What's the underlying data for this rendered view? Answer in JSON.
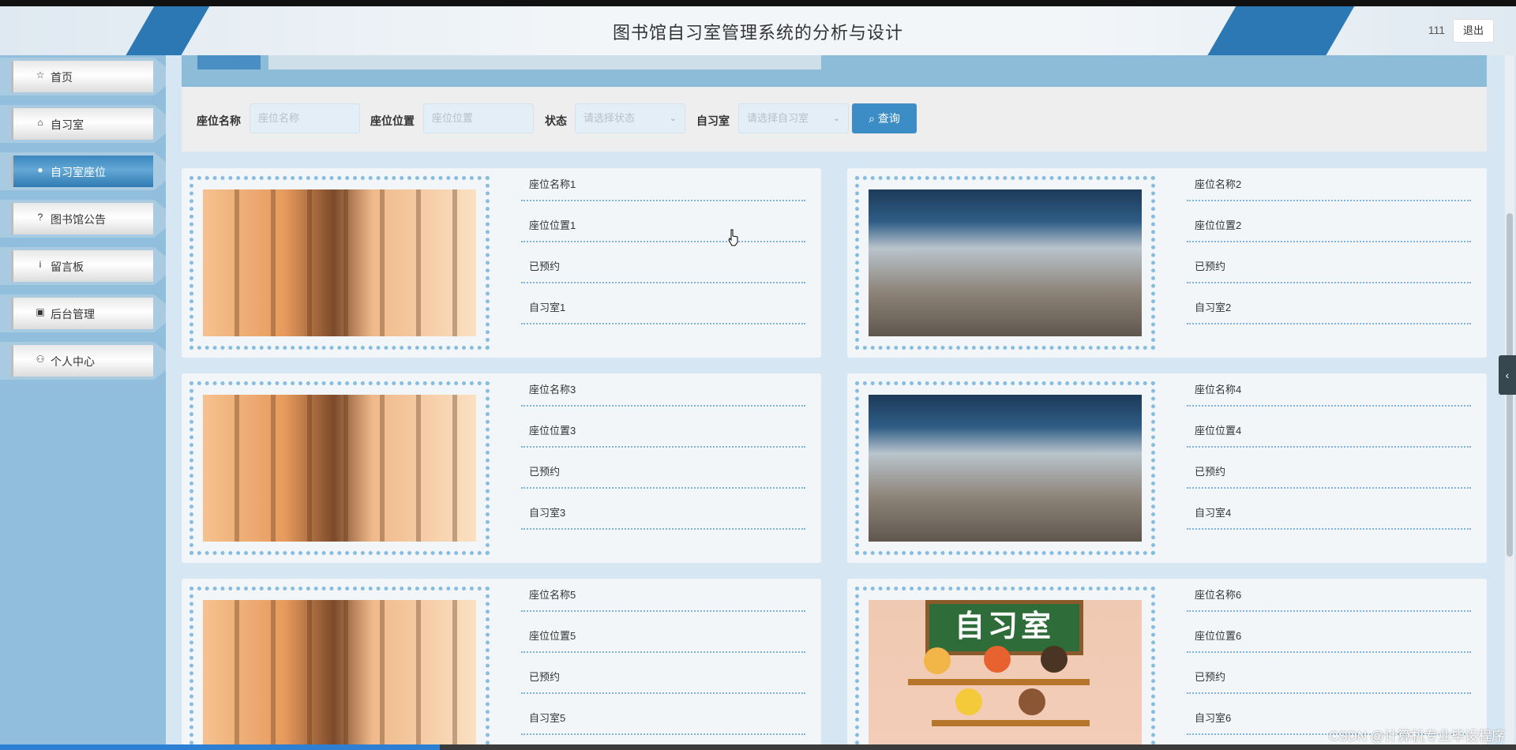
{
  "header": {
    "title": "图书馆自习室管理系统的分析与设计",
    "user": "111",
    "logout_label": "退出"
  },
  "sidebar": {
    "items": [
      {
        "label": "首页",
        "icon": "star-icon"
      },
      {
        "label": "自习室",
        "icon": "lock-icon"
      },
      {
        "label": "自习室座位",
        "icon": "info-circle-icon",
        "active": true
      },
      {
        "label": "图书馆公告",
        "icon": "question-circle-icon"
      },
      {
        "label": "留言板",
        "icon": "info-icon"
      },
      {
        "label": "后台管理",
        "icon": "briefcase-icon"
      },
      {
        "label": "个人中心",
        "icon": "user-icon"
      }
    ]
  },
  "search": {
    "seat_name_label": "座位名称",
    "seat_name_placeholder": "座位名称",
    "seat_location_label": "座位位置",
    "seat_location_placeholder": "座位位置",
    "status_label": "状态",
    "status_placeholder": "请选择状态",
    "room_label": "自习室",
    "room_placeholder": "请选择自习室",
    "query_label": "查询"
  },
  "seats": [
    {
      "name": "座位名称1",
      "location": "座位位置1",
      "status": "已预约",
      "room": "自习室1",
      "image": "room-a"
    },
    {
      "name": "座位名称2",
      "location": "座位位置2",
      "status": "已预约",
      "room": "自习室2",
      "image": "room-b"
    },
    {
      "name": "座位名称3",
      "location": "座位位置3",
      "status": "已预约",
      "room": "自习室3",
      "image": "room-a"
    },
    {
      "name": "座位名称4",
      "location": "座位位置4",
      "status": "已预约",
      "room": "自习室4",
      "image": "room-b"
    },
    {
      "name": "座位名称5",
      "location": "座位位置5",
      "status": "已预约",
      "room": "自习室5",
      "image": "room-a"
    },
    {
      "name": "座位名称6",
      "location": "座位位置6",
      "status": "已预约",
      "room": "自习室6",
      "image": "room-c",
      "image_text": "自习室"
    }
  ],
  "watermark": "CSDN @计算机专业毕设程序",
  "colors": {
    "accent": "#2b78b4",
    "sidebar_bg": "#90bedc",
    "query_button": "#3c8dc6",
    "dotted_border": "#87bde0"
  },
  "video_progress": 0.29
}
